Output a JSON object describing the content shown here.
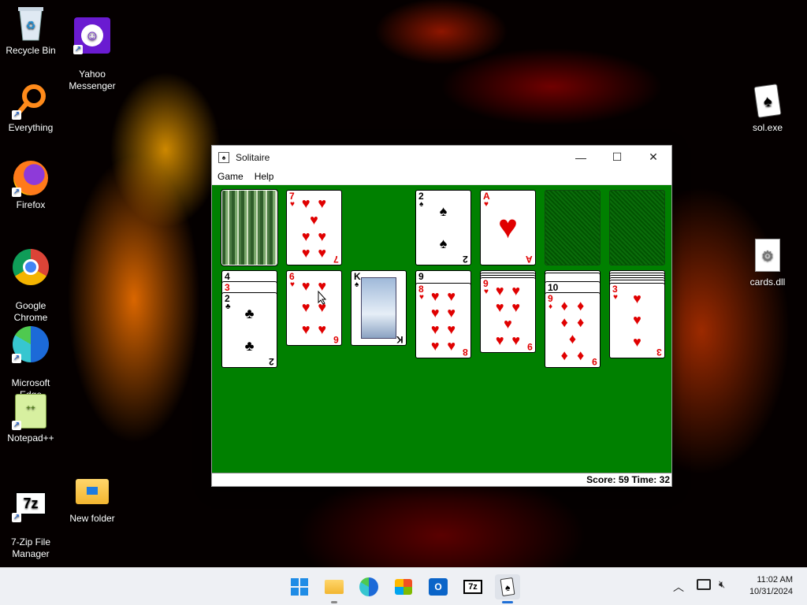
{
  "desktop": {
    "icons": [
      {
        "label": "Recycle Bin",
        "icon": "recycle-bin-icon"
      },
      {
        "label": "Yahoo\nMessenger",
        "icon": "yahoo-messenger-icon"
      },
      {
        "label": "Everything",
        "icon": "everything-search-icon"
      },
      {
        "label": "Firefox",
        "icon": "firefox-icon"
      },
      {
        "label": "Google\nChrome",
        "icon": "chrome-icon"
      },
      {
        "label": "Microsoft\nEdge",
        "icon": "edge-icon"
      },
      {
        "label": "Notepad++",
        "icon": "notepad-plus-plus-icon"
      },
      {
        "label": "7-Zip File\nManager",
        "icon": "seven-zip-icon"
      },
      {
        "label": "New folder",
        "icon": "folder-icon"
      },
      {
        "label": "sol.exe",
        "icon": "solitaire-exe-icon"
      },
      {
        "label": "cards.dll",
        "icon": "dll-file-icon"
      }
    ]
  },
  "window": {
    "title": "Solitaire",
    "menu": [
      "Game",
      "Help"
    ],
    "status": "Score: 59 Time: 32"
  },
  "game": {
    "stock": {
      "state": "face-down",
      "back": "bamboo"
    },
    "waste": {
      "rank": "7",
      "suit": "♥"
    },
    "foundations": [
      {
        "rank": "2",
        "suit": "♠"
      },
      {
        "rank": "A",
        "suit": "♥"
      },
      {
        "rank": "",
        "suit": ""
      },
      {
        "rank": "",
        "suit": ""
      }
    ],
    "tableau": [
      {
        "cards": [
          {
            "rank": "4",
            "suit": "♣"
          },
          {
            "rank": "3",
            "suit": "♥"
          },
          {
            "rank": "2",
            "suit": "♣"
          }
        ]
      },
      {
        "cards": [
          {
            "rank": "6",
            "suit": "♥"
          }
        ]
      },
      {
        "cards": [
          {
            "rank": "K",
            "suit": "♠"
          }
        ]
      },
      {
        "cards": [
          {
            "rank": "9",
            "suit": "♠"
          },
          {
            "rank": "8",
            "suit": "♥"
          }
        ]
      },
      {
        "cards": [
          {
            "rank": "9",
            "suit": "♥"
          }
        ]
      },
      {
        "cards": [
          {
            "rank": "10",
            "suit": "♠"
          },
          {
            "rank": "9",
            "suit": "♦"
          }
        ]
      },
      {
        "cards": [
          {
            "rank": "3",
            "suit": "♥"
          }
        ]
      }
    ]
  },
  "taskbar": {
    "clock_time": "11:02 AM",
    "clock_date": "10/31/2024",
    "apps": [
      "start-icon",
      "file-explorer-icon",
      "edge-icon",
      "store-icon",
      "outlook-icon",
      "seven-zip-icon",
      "solitaire-icon"
    ]
  },
  "colors": {
    "felt": "#008000",
    "red_suit": "#e00000",
    "taskbar": "#eef0f4"
  }
}
